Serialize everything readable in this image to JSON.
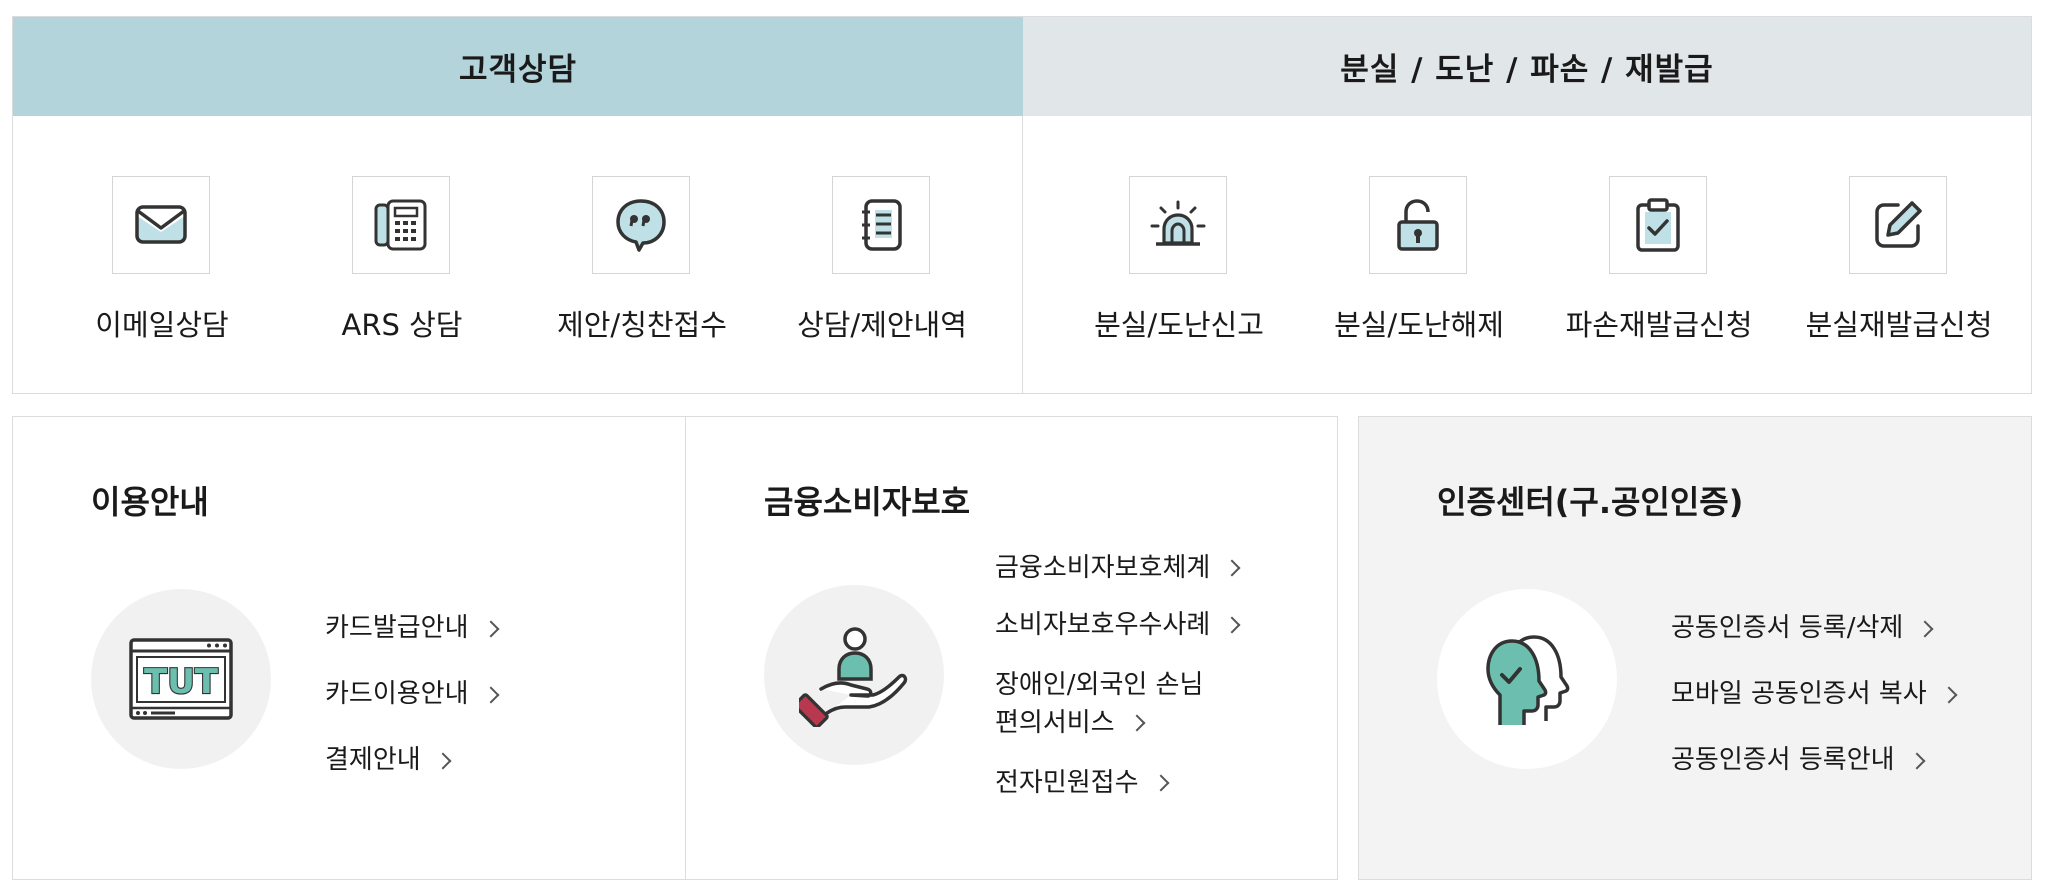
{
  "top": {
    "left_tab": "고객상담",
    "right_tab": "분실 / 도난 / 파손 / 재발급",
    "items": [
      {
        "label": "이메일상담",
        "icon": "envelope-icon"
      },
      {
        "label": "ARS 상담",
        "icon": "phone-icon"
      },
      {
        "label": "제안/칭찬접수",
        "icon": "speech-bubble-icon"
      },
      {
        "label": "상담/제안내역",
        "icon": "notebook-icon"
      },
      {
        "label": "분실/도난신고",
        "icon": "siren-icon"
      },
      {
        "label": "분실/도난해제",
        "icon": "unlock-icon"
      },
      {
        "label": "파손재발급신청",
        "icon": "clipboard-check-icon"
      },
      {
        "label": "분실재발급신청",
        "icon": "edit-icon"
      }
    ]
  },
  "guide": {
    "title": "이용안내",
    "icon": "browser-window-icon",
    "links": [
      "카드발급안내",
      "카드이용안내",
      "결제안내"
    ]
  },
  "protect": {
    "title": "금융소비자보호",
    "icon": "hand-person-icon",
    "links": [
      "금융소비자보호체계",
      "소비자보호우수사례",
      "장애인/외국인 손님",
      "편의서비스",
      "전자민원접수"
    ]
  },
  "cert": {
    "title": "인증센터(구.공인인증)",
    "icon": "face-check-icon",
    "links": [
      "공동인증서 등록/삭제",
      "모바일 공동인증서 복사",
      "공동인증서 등록안내"
    ]
  },
  "colors": {
    "tab_active": "#b4d4db",
    "tab_inactive": "#e1e6e9",
    "accent_teal": "#6cbfae",
    "accent_red": "#b8384f"
  }
}
